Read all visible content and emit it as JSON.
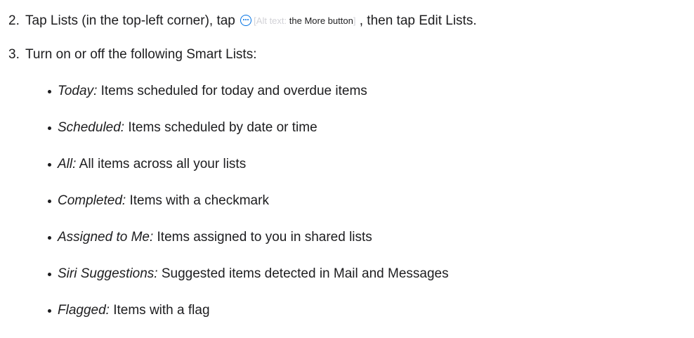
{
  "steps": [
    {
      "number": "2.",
      "before_icon": "Tap Lists (in the top-left corner), tap",
      "icon": "more-icon",
      "alt_open": "[",
      "alt_label": "Alt text:",
      "alt_value": "the More button",
      "alt_close": "]",
      "after_icon": ", then tap Edit Lists."
    },
    {
      "number": "3.",
      "text": "Turn on or off the following Smart Lists:"
    }
  ],
  "smart_lists": [
    {
      "term": "Today:",
      "description": "Items scheduled for today and overdue items"
    },
    {
      "term": "Scheduled:",
      "description": "Items scheduled by date or time"
    },
    {
      "term": "All:",
      "description": "All items across all your lists"
    },
    {
      "term": "Completed:",
      "description": "Items with a checkmark"
    },
    {
      "term": "Assigned to Me:",
      "description": "Items assigned to you in shared lists"
    },
    {
      "term": "Siri Suggestions:",
      "description": "Suggested items detected in Mail and Messages"
    },
    {
      "term": "Flagged:",
      "description": "Items with a flag"
    }
  ],
  "colors": {
    "text": "#1d1d1f",
    "accent": "#0071e3",
    "alt_text_muted": "#d2d2d7"
  }
}
